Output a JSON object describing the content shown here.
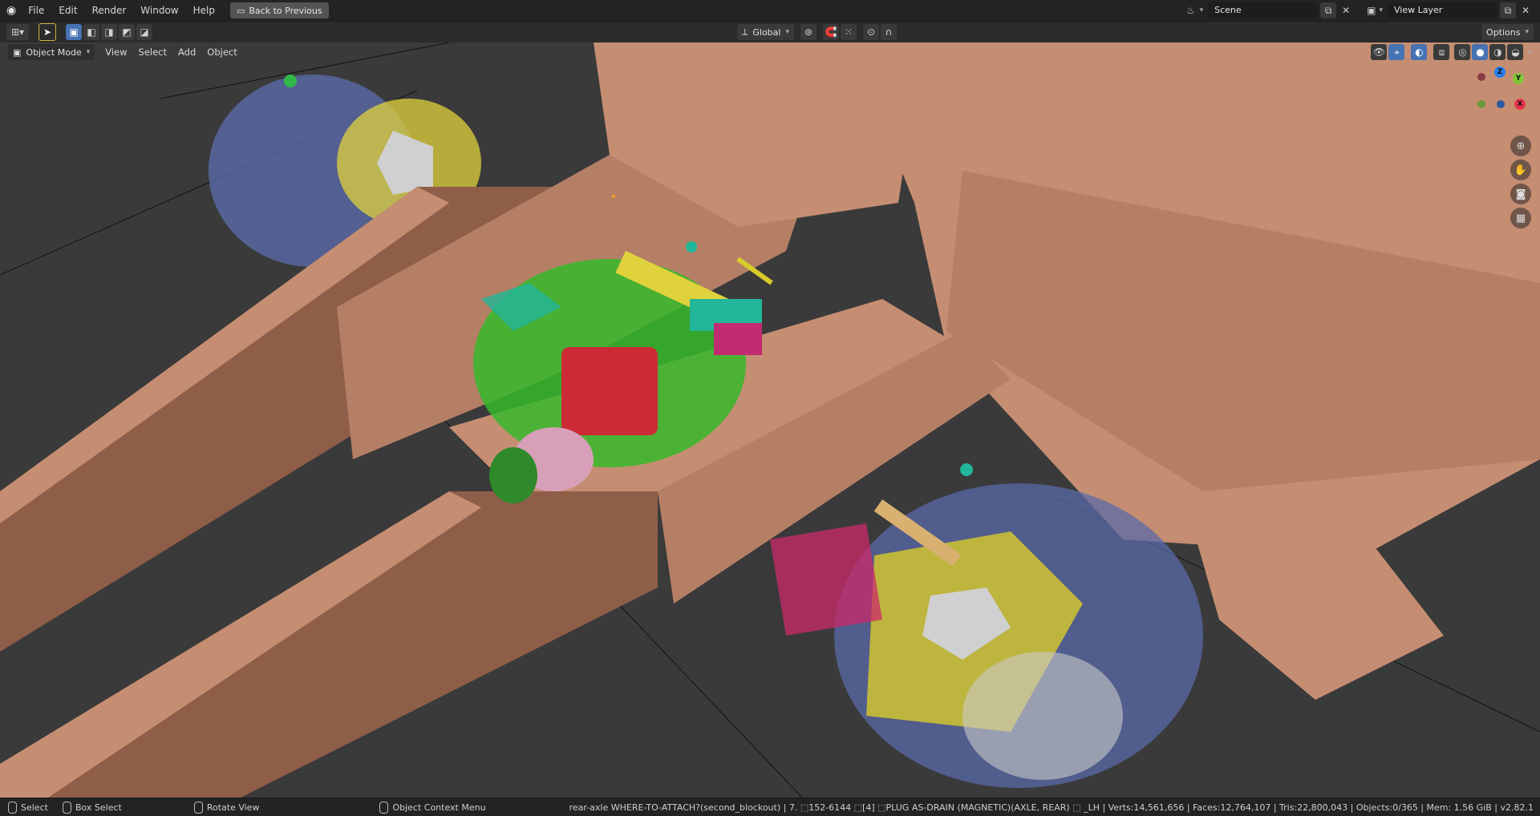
{
  "menu": {
    "items": [
      "File",
      "Edit",
      "Render",
      "Window",
      "Help"
    ],
    "back_label": "Back to Previous"
  },
  "scene": {
    "name": "Scene"
  },
  "view_layer": {
    "name": "View Layer"
  },
  "toolbar": {
    "transform_orientation": "Global",
    "options_label": "Options"
  },
  "header": {
    "mode": "Object Mode",
    "menus": [
      "View",
      "Select",
      "Add",
      "Object"
    ]
  },
  "gizmo": {
    "z": "Z",
    "y": "Y",
    "x": "X"
  },
  "status": {
    "select": "Select",
    "box_select": "Box Select",
    "rotate_view": "Rotate View",
    "context_menu": "Object Context Menu",
    "info": "rear-axle WHERE-TO-ATTACH?(second_blockout) | 7. ⬚152-6144 ⬚[4] ⬚PLUG AS-DRAIN (MAGNETIC)(AXLE, REAR) ⬚ _LH | Verts:14,561,656 | Faces:12,764,107 | Tris:22,800,043 | Objects:0/365 | Mem: 1.56 GiB | v2.82.1"
  },
  "colors": {
    "frame": "#c58e72",
    "frame_shadow": "#8f5e48",
    "hub_blue": "#5a6aa8",
    "gear_green": "#35b82a",
    "yellow": "#d8cc2a",
    "red": "#cc2a35",
    "magenta": "#c22a72",
    "teal": "#22b69a",
    "background": "#3a3a3a"
  }
}
